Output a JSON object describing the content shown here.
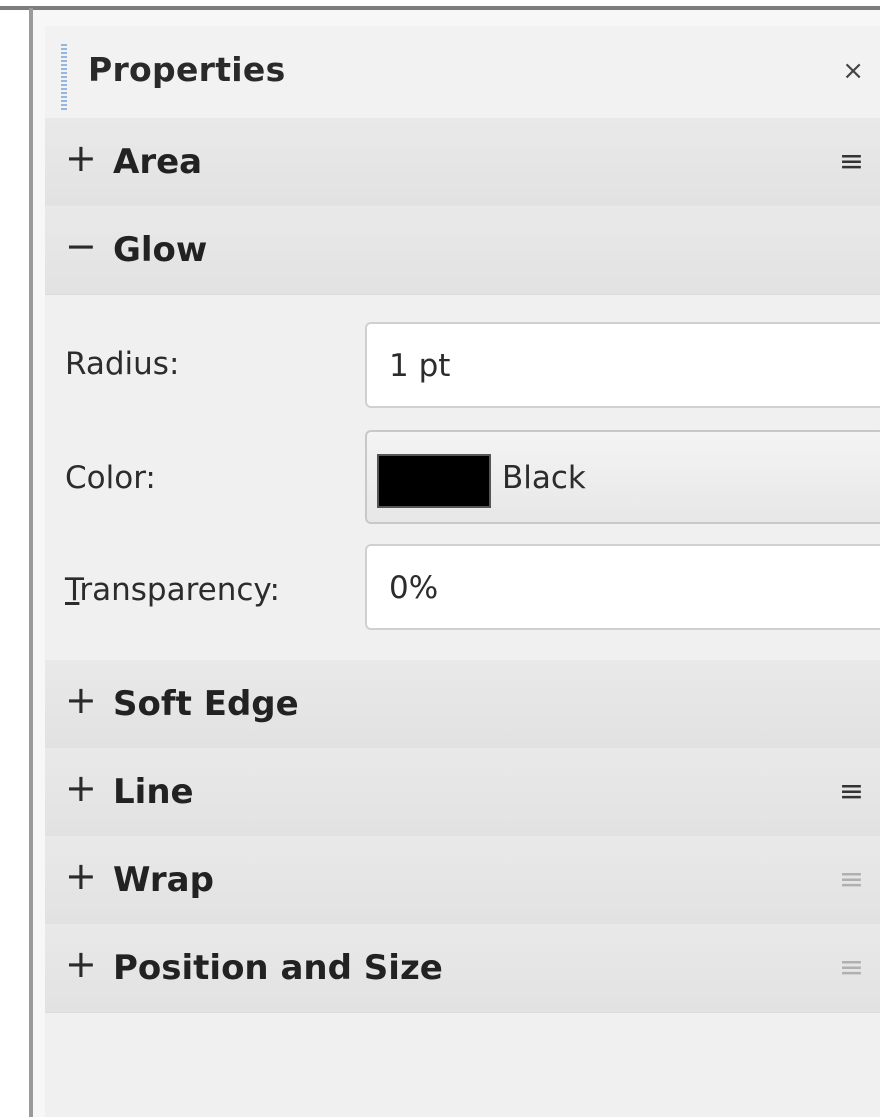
{
  "panel": {
    "title": "Properties",
    "close_glyph": "×"
  },
  "sections": {
    "area": {
      "sign": "+",
      "label": "Area",
      "menu_glyph": "≡"
    },
    "glow": {
      "sign": "−",
      "label": "Glow"
    },
    "soft_edge": {
      "sign": "+",
      "label": "Soft Edge"
    },
    "line": {
      "sign": "+",
      "label": "Line",
      "menu_glyph": "≡"
    },
    "wrap": {
      "sign": "+",
      "label": "Wrap",
      "menu_glyph": "≡"
    },
    "position_size": {
      "sign": "+",
      "label": "Position and Size",
      "menu_glyph": "≡"
    }
  },
  "glow": {
    "radius_label": "Radius:",
    "radius_value": "1 pt",
    "color_label": "Color:",
    "color_value": "Black",
    "color_swatch": "#000000",
    "transparency_label": "Transparency:",
    "transparency_value": "0%"
  },
  "icons": {
    "close": "close-icon",
    "menu": "hamburger-menu-icon",
    "expand": "plus-icon",
    "collapse": "minus-icon"
  }
}
